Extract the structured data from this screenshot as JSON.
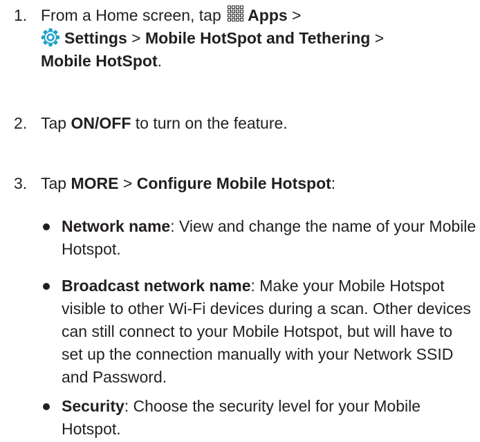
{
  "steps": [
    {
      "number": "1.",
      "pre": "From a Home screen, tap ",
      "apps_icon": "apps-grid-icon",
      "apps": "Apps",
      "sep1": " >",
      "settings_icon": "settings-gear-icon",
      "settings": "Settings",
      "sep2": " > ",
      "mhat": "Mobile HotSpot and Tethering",
      "sep3": " >",
      "mhs": "Mobile HotSpot",
      "end": "."
    },
    {
      "number": "2.",
      "pre": "Tap ",
      "onoff": "ON/OFF",
      "post": " to turn on the feature."
    },
    {
      "number": "3.",
      "pre": "Tap ",
      "more": "MORE",
      "sep": " > ",
      "configure": "Configure Mobile Hotspot",
      "end": ":"
    }
  ],
  "bullets": [
    {
      "term": "Network name",
      "desc": ": View and change the name of your Mobile Hotspot."
    },
    {
      "term": "Broadcast network name",
      "desc": ": Make your Mobile Hotspot visible to other Wi-Fi devices during a scan. Other devices can still connect to your Mobile Hotspot, but will have to set up the connection manually with your Network SSID and Password."
    },
    {
      "term": "Security",
      "desc": ": Choose the security level for your Mobile Hotspot."
    }
  ],
  "colors": {
    "text": "#231f20",
    "settings_icon": "#1ba1c7"
  }
}
